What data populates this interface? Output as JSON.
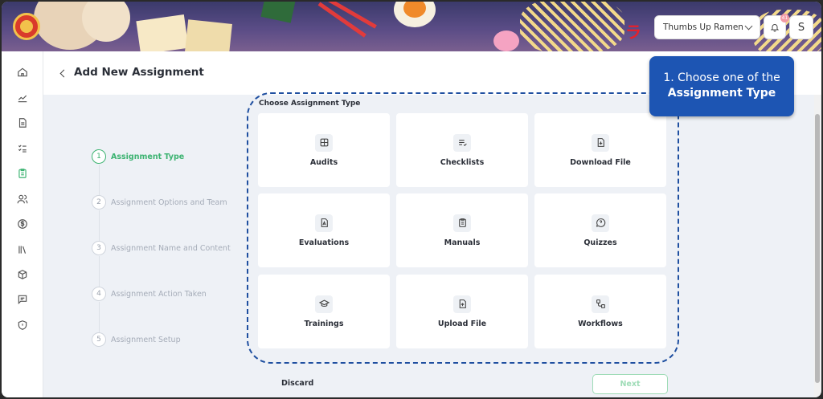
{
  "header": {
    "brand_selector": "Thumbs Up Ramen",
    "notification_count": "41",
    "avatar_initial": "S",
    "mark": "ラ"
  },
  "sidebar": {
    "items": [
      {
        "name": "home-icon",
        "active": false
      },
      {
        "name": "analytics-icon",
        "active": false
      },
      {
        "name": "document-icon",
        "active": false
      },
      {
        "name": "tasks-icon",
        "active": false
      },
      {
        "name": "assignments-icon",
        "active": true
      },
      {
        "name": "users-icon",
        "active": false
      },
      {
        "name": "dollar-icon",
        "active": false
      },
      {
        "name": "library-icon",
        "active": false
      },
      {
        "name": "box-icon",
        "active": false
      },
      {
        "name": "message-icon",
        "active": false
      },
      {
        "name": "shield-icon",
        "active": false
      }
    ]
  },
  "page": {
    "title": "Add New Assignment",
    "section_label": "Choose Assignment Type"
  },
  "steps": [
    {
      "number": "1",
      "label": "Assignment Type",
      "active": true
    },
    {
      "number": "2",
      "label": "Assignment Options and Team",
      "active": false
    },
    {
      "number": "3",
      "label": "Assignment Name and Content",
      "active": false
    },
    {
      "number": "4",
      "label": "Assignment Action Taken",
      "active": false
    },
    {
      "number": "5",
      "label": "Assignment Setup",
      "active": false
    }
  ],
  "types": [
    {
      "label": "Audits",
      "icon": "grid-icon"
    },
    {
      "label": "Checklists",
      "icon": "checklist-icon"
    },
    {
      "label": "Download File",
      "icon": "download-file-icon"
    },
    {
      "label": "Evaluations",
      "icon": "evaluation-icon"
    },
    {
      "label": "Manuals",
      "icon": "clipboard-icon"
    },
    {
      "label": "Quizzes",
      "icon": "question-bubble-icon"
    },
    {
      "label": "Trainings",
      "icon": "graduation-cap-icon"
    },
    {
      "label": "Upload File",
      "icon": "upload-file-icon"
    },
    {
      "label": "Workflows",
      "icon": "workflow-icon"
    }
  ],
  "actions": {
    "discard": "Discard",
    "next": "Next"
  },
  "callout": {
    "line1": "1. Choose one of the",
    "line2": "Assignment Type"
  },
  "colors": {
    "accent_green": "#3cb371",
    "callout_blue": "#1d55b3",
    "dashed_border": "#1f4fa0"
  }
}
